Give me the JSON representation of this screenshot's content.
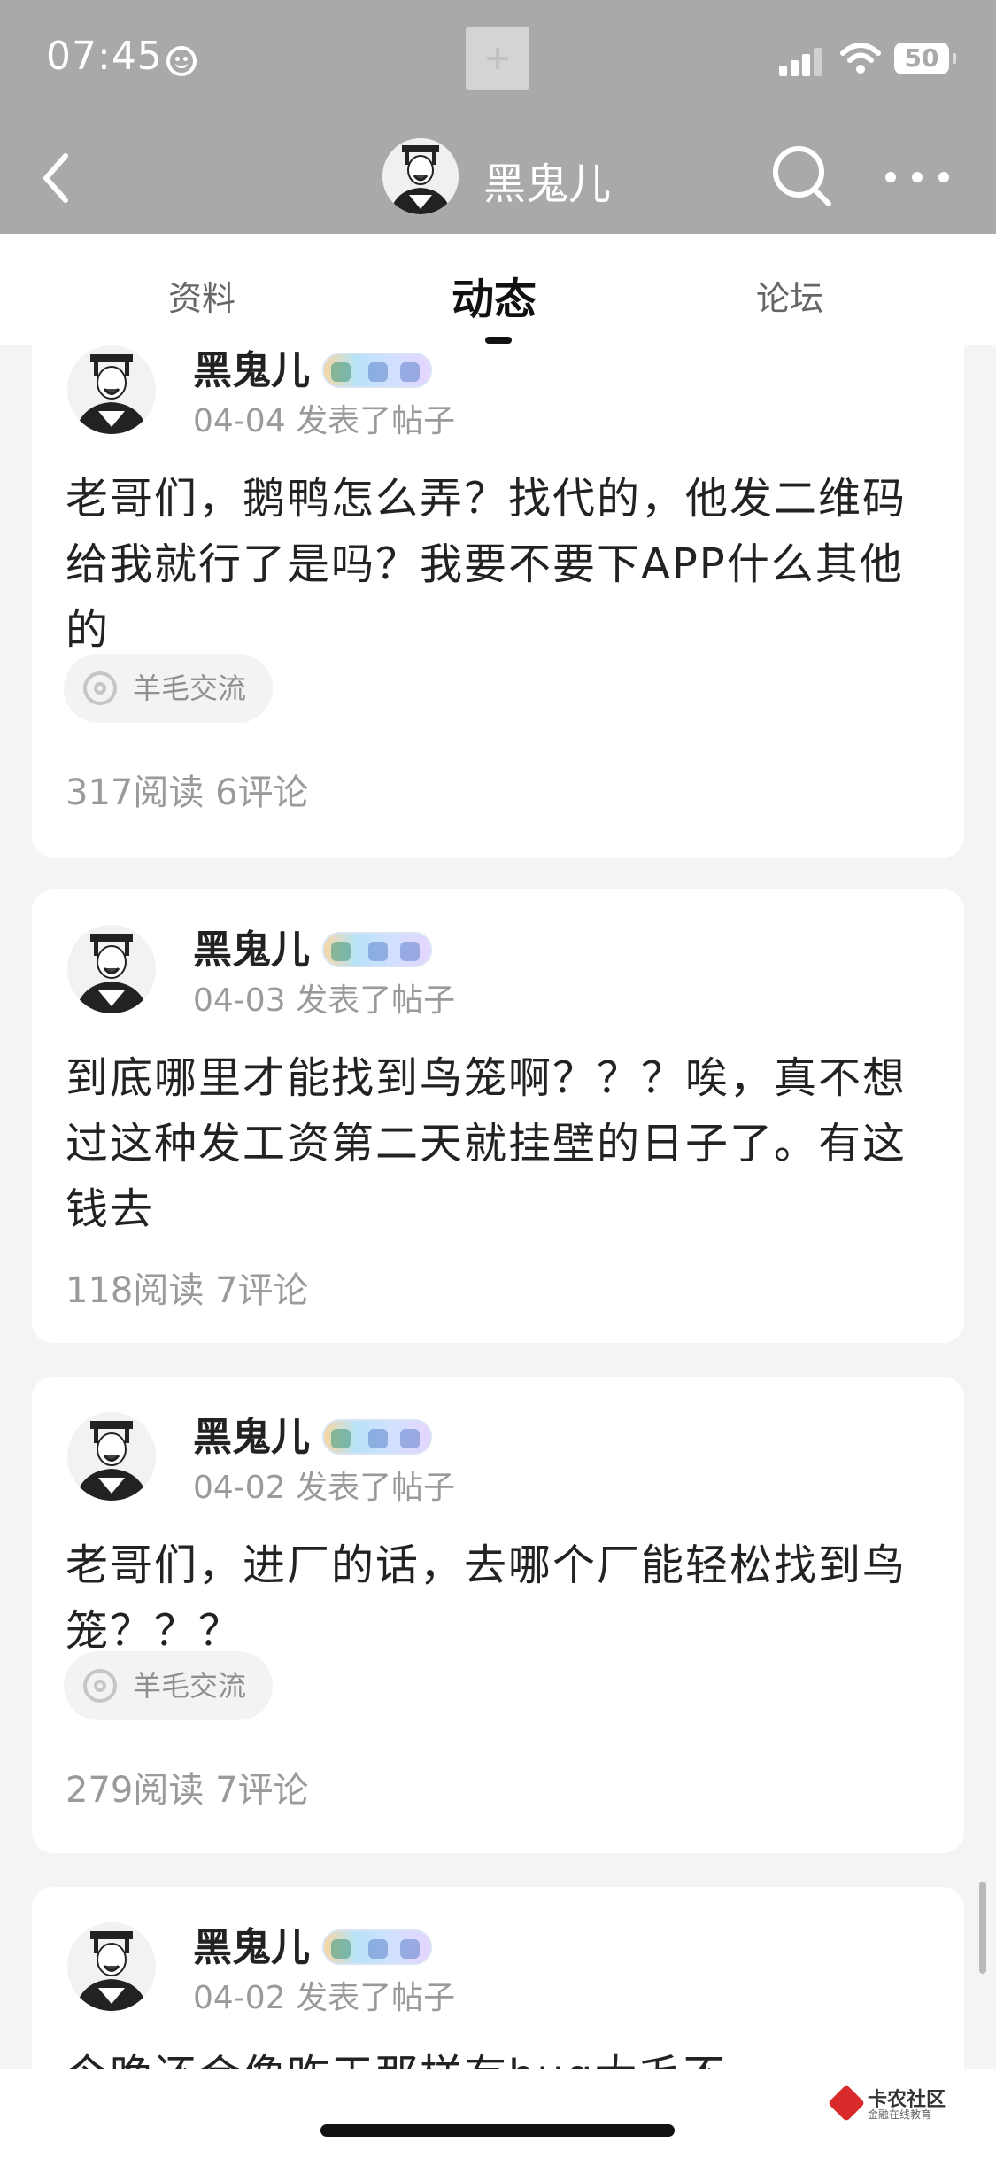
{
  "status_bar": {
    "time": "07:45",
    "battery": "50"
  },
  "nav": {
    "title": "黑鬼儿"
  },
  "tabs": [
    {
      "label": "资料"
    },
    {
      "label": "动态"
    },
    {
      "label": "论坛"
    }
  ],
  "posts": [
    {
      "author": "黑鬼儿",
      "date": "04-04",
      "action": "发表了帖子",
      "content": "老哥们，鹅鸭怎么弄？找代的，他发二维码给我就行了是吗？我要不要下APP什么其他的",
      "tag": "羊毛交流",
      "reads": "317阅读",
      "comments": "6评论"
    },
    {
      "author": "黑鬼儿",
      "date": "04-03",
      "action": "发表了帖子",
      "content": "到底哪里才能找到鸟笼啊？？？唉，真不想过这种发工资第二天就挂壁的日子了。有这钱去",
      "reads": "118阅读",
      "comments": "7评论"
    },
    {
      "author": "黑鬼儿",
      "date": "04-02",
      "action": "发表了帖子",
      "content": "老哥们，进厂的话，去哪个厂能轻松找到鸟笼？？？",
      "tag": "羊毛交流",
      "reads": "279阅读",
      "comments": "7评论"
    },
    {
      "author": "黑鬼儿",
      "date": "04-02",
      "action": "发表了帖子",
      "content": "今晚还会像昨天那样有bug大毛不"
    }
  ],
  "watermark": {
    "name": "卡农社区",
    "sub": "金融在线教育"
  }
}
